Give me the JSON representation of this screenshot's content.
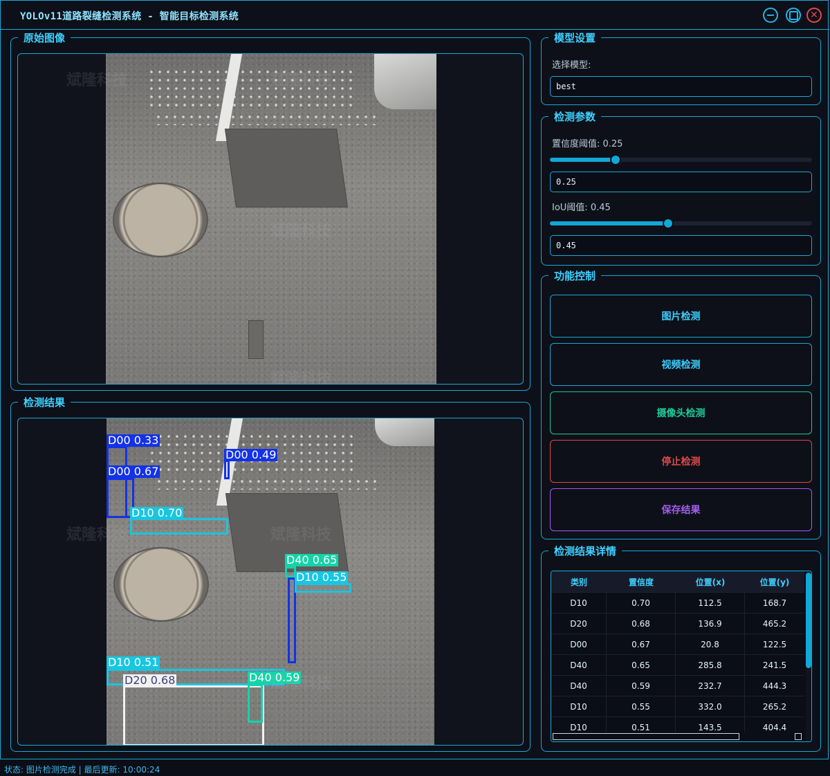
{
  "window": {
    "title": "YOLOv11道路裂缝检测系统 - 智能目标检测系统"
  },
  "original_panel": {
    "title": "原始图像"
  },
  "result_panel": {
    "title": "检测结果"
  },
  "watermark": "斌隆科技",
  "detections_overlay": [
    {
      "label": "D00 0.33",
      "color": "#1432e6"
    },
    {
      "label": "D00 0.67",
      "color": "#1432e6"
    },
    {
      "label": "D00 0.49",
      "color": "#1432e6"
    },
    {
      "label": "D10 0.70",
      "color": "#19c6e0"
    },
    {
      "label": "D40 0.65",
      "color": "#14d3a8"
    },
    {
      "label": "D10 0.55",
      "color": "#19c6e0"
    },
    {
      "label": "D10 0.51",
      "color": "#19c6e0"
    },
    {
      "label": "D20 0.68",
      "color": "#f2f2f2"
    },
    {
      "label": "D40 0.59",
      "color": "#14d3a8"
    }
  ],
  "model_settings": {
    "title": "模型设置",
    "select_label": "选择模型:",
    "model_value": "best"
  },
  "detect_params": {
    "title": "检测参数",
    "conf_label": "置信度阈值: 0.25",
    "conf_value": "0.25",
    "conf_fraction": 0.25,
    "iou_label": "IoU阈值: 0.45",
    "iou_value": "0.45",
    "iou_fraction": 0.45
  },
  "controls": {
    "title": "功能控制",
    "image_detect": "图片检测",
    "video_detect": "视频检测",
    "camera_detect": "摄像头检测",
    "stop_detect": "停止检测",
    "save_result": "保存结果"
  },
  "details": {
    "title": "检测结果详情",
    "headers": [
      "类别",
      "置信度",
      "位置(x)",
      "位置(y)"
    ],
    "rows": [
      [
        "D10",
        "0.70",
        "112.5",
        "168.7"
      ],
      [
        "D20",
        "0.68",
        "136.9",
        "465.2"
      ],
      [
        "D00",
        "0.67",
        "20.8",
        "122.5"
      ],
      [
        "D40",
        "0.65",
        "285.8",
        "241.5"
      ],
      [
        "D40",
        "0.59",
        "232.7",
        "444.3"
      ],
      [
        "D10",
        "0.55",
        "332.0",
        "265.2"
      ],
      [
        "D10",
        "0.51",
        "143.5",
        "404.4"
      ]
    ]
  },
  "status_bar": {
    "text": "状态: 图片检测完成 | 最后更新: 10:00:24"
  },
  "colors": {
    "accent": "#1aa9d6",
    "title_text": "#3fd0ff",
    "stop_red": "#e04a4a",
    "camera_green": "#1ec99a",
    "save_purple": "#a35cf0"
  }
}
